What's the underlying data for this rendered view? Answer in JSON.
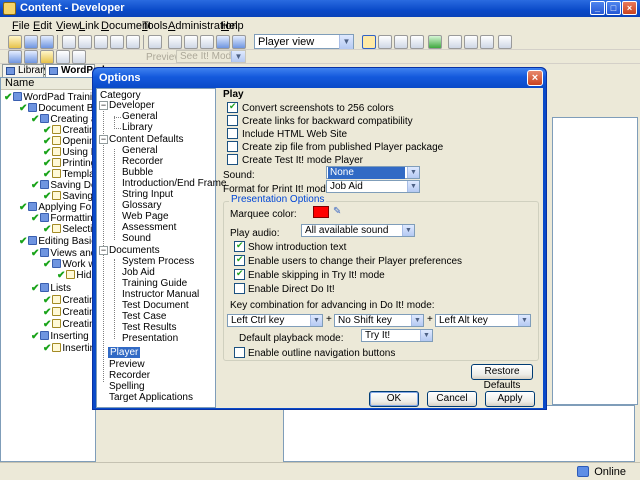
{
  "window": {
    "title": "Content - Developer"
  },
  "menu": [
    "File",
    "Edit",
    "View",
    "Link",
    "Document",
    "Tools",
    "Administration",
    "Help"
  ],
  "toolbar": {
    "view_mode": "Player view",
    "preview_label": "Preview:",
    "preview_mode": "See It! Mode"
  },
  "tabs": [
    {
      "label": "Library"
    },
    {
      "label": "WordPad"
    }
  ],
  "tree": {
    "column_header": "Name",
    "items": [
      "WordPad Training",
      "Document Basic",
      "Creating an",
      "Creating",
      "Opening",
      "Using P",
      "Printing",
      "Templat",
      "Saving Docu",
      "Saving d",
      "Applying Forma",
      "Formatting",
      "Selectin",
      "Editing Basics",
      "Views and T",
      "Work w",
      "Hidir",
      "Lists",
      "Creatin",
      "Creatin",
      "Creatin",
      "Inserting Da",
      "Insertin"
    ]
  },
  "status": {
    "online": "Online"
  },
  "dialog": {
    "title": "Options",
    "category_header": "Category",
    "categories": [
      "Developer",
      "General",
      "Library",
      "Content Defaults",
      "General",
      "Recorder",
      "Bubble",
      "Introduction/End Frame",
      "String Input",
      "Glossary",
      "Web Page",
      "Assessment",
      "Sound",
      "Documents",
      "System Process",
      "Job Aid",
      "Training Guide",
      "Instructor Manual",
      "Test Document",
      "Test Case",
      "Test Results",
      "Presentation",
      "Player",
      "Preview",
      "Recorder",
      "Spelling",
      "Target Applications"
    ],
    "selected_category": "Player",
    "section_title": "Play",
    "checks": [
      {
        "label": "Convert screenshots to 256 colors",
        "checked": true
      },
      {
        "label": "Create links for backward compatibility",
        "checked": false
      },
      {
        "label": "Include HTML Web Site",
        "checked": false
      },
      {
        "label": "Create zip file from published Player package",
        "checked": false
      },
      {
        "label": "Create Test It! mode Player",
        "checked": false
      }
    ],
    "sound": {
      "label": "Sound:",
      "value": "None"
    },
    "print_mode": {
      "label": "Format for Print It! mode:",
      "value": "Job Aid"
    },
    "presentation": {
      "title": "Presentation Options",
      "marquee_label": "Marquee color:",
      "marquee_color": "#ff0000",
      "play_audio_label": "Play audio:",
      "play_audio_value": "All available sound",
      "checks": [
        {
          "label": "Show introduction text",
          "checked": true
        },
        {
          "label": "Enable users to change their Player preferences",
          "checked": true
        },
        {
          "label": "Enable skipping in Try It! mode",
          "checked": true
        },
        {
          "label": "Enable Direct Do It!",
          "checked": false
        }
      ],
      "key_combo_label": "Key combination for advancing in Do It! mode:",
      "key1": "Left Ctrl key",
      "key2": "No Shift key",
      "key3": "Left Alt key",
      "plus": "+",
      "playback_label": "Default playback mode:",
      "playback_value": "Try It!",
      "outline_label": "Enable outline navigation buttons",
      "outline_checked": false
    },
    "buttons": {
      "restore": "Restore Defaults",
      "ok": "OK",
      "cancel": "Cancel",
      "apply": "Apply"
    }
  }
}
